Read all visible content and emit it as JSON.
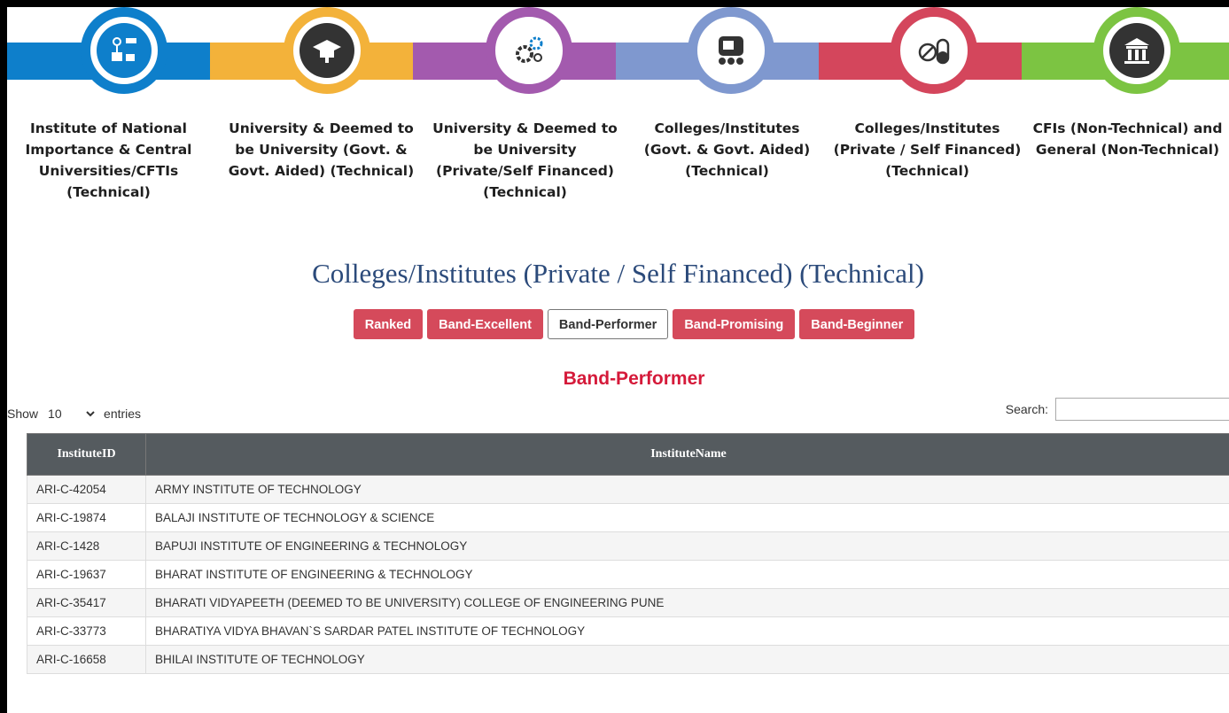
{
  "categories": [
    {
      "lines": [
        "Institute of National",
        "Importance & Central",
        "Universities/CFTIs",
        "(Technical)"
      ],
      "color": "#0e7fcb",
      "icon": "network-icon"
    },
    {
      "lines": [
        "University & Deemed to",
        "be University (Govt. &",
        "Govt. Aided) (Technical)"
      ],
      "color": "#f3b23a",
      "icon": "graduation-icon"
    },
    {
      "lines": [
        "University & Deemed to",
        "be University",
        "(Private/Self Financed)",
        "(Technical)"
      ],
      "color": "#a35aae",
      "icon": "gears-icon"
    },
    {
      "lines": [
        "Colleges/Institutes",
        "(Govt. & Govt. Aided)",
        "(Technical)"
      ],
      "color": "#7f98cf",
      "icon": "classroom-icon"
    },
    {
      "lines": [
        "Colleges/Institutes",
        "(Private / Self Financed)",
        "(Technical)"
      ],
      "color": "#d4465c",
      "icon": "pill-icon"
    },
    {
      "lines": [
        "CFIs (Non-Technical) and",
        "General (Non-Technical)"
      ],
      "color": "#7cc442",
      "icon": "building-icon"
    }
  ],
  "page_title": "Colleges/Institutes (Private / Self Financed) (Technical)",
  "tabs": [
    {
      "label": "Ranked",
      "active": false
    },
    {
      "label": "Band-Excellent",
      "active": false
    },
    {
      "label": "Band-Performer",
      "active": true
    },
    {
      "label": "Band-Promising",
      "active": false
    },
    {
      "label": "Band-Beginner",
      "active": false
    }
  ],
  "section_heading": "Band-Performer",
  "length": {
    "show_label": "Show",
    "value": "10",
    "entries_label": "entries"
  },
  "search": {
    "label": "Search:",
    "value": ""
  },
  "table": {
    "headers": [
      "InstituteID",
      "InstituteName"
    ],
    "rows": [
      [
        "ARI-C-42054",
        "ARMY INSTITUTE OF TECHNOLOGY"
      ],
      [
        "ARI-C-19874",
        "BALAJI INSTITUTE OF TECHNOLOGY & SCIENCE"
      ],
      [
        "ARI-C-1428",
        "BAPUJI INSTITUTE OF ENGINEERING & TECHNOLOGY"
      ],
      [
        "ARI-C-19637",
        "BHARAT INSTITUTE OF ENGINEERING & TECHNOLOGY"
      ],
      [
        "ARI-C-35417",
        "BHARATI VIDYAPEETH (DEEMED TO BE UNIVERSITY) COLLEGE OF ENGINEERING PUNE"
      ],
      [
        "ARI-C-33773",
        "BHARATIYA VIDYA BHAVAN`S SARDAR PATEL INSTITUTE OF TECHNOLOGY"
      ],
      [
        "ARI-C-16658",
        "BHILAI INSTITUTE OF TECHNOLOGY"
      ]
    ]
  }
}
